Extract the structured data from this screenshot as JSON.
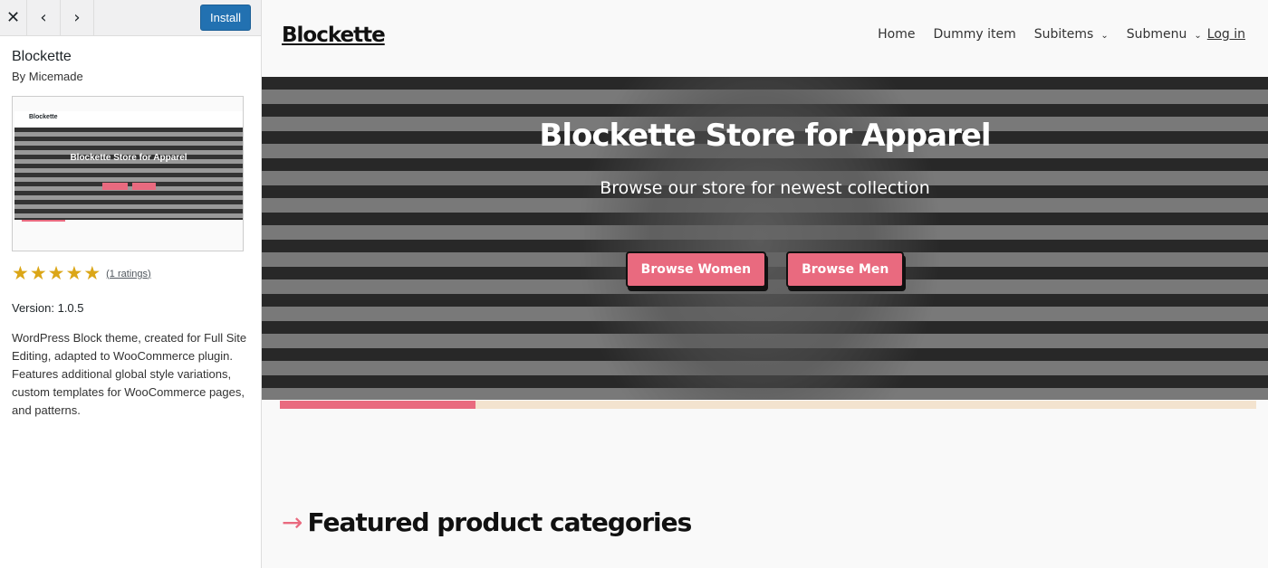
{
  "sidebar": {
    "close_icon": "close-icon",
    "prev_icon": "chevron-left-icon",
    "next_icon": "chevron-right-icon",
    "install_label": "Install",
    "theme_name": "Blockette",
    "author": "By Micemade",
    "rating": 5,
    "rating_max": 5,
    "ratings_label": "(1 ratings)",
    "version": "Version: 1.0.5",
    "description": "WordPress Block theme, created for Full Site Editing, adapted to WooCommerce plugin. Features additional global style variations, custom templates for WooCommerce pages, and patterns."
  },
  "preview": {
    "logo": "Blockette",
    "nav": [
      "Home",
      "Dummy item",
      "Subitems",
      "Submenu",
      "Log in"
    ],
    "hero_title": "Blockette Store for Apparel",
    "hero_subtitle": "Browse our store for newest collection",
    "btn_women": "Browse Women",
    "btn_men": "Browse Men",
    "progress_percent": 20,
    "featured_heading": "Featured product categories",
    "arrow": "→"
  },
  "colors": {
    "accent": "#e96a7f",
    "install": "#2271b1",
    "star": "#dba617",
    "track": "#f3e3cf"
  }
}
